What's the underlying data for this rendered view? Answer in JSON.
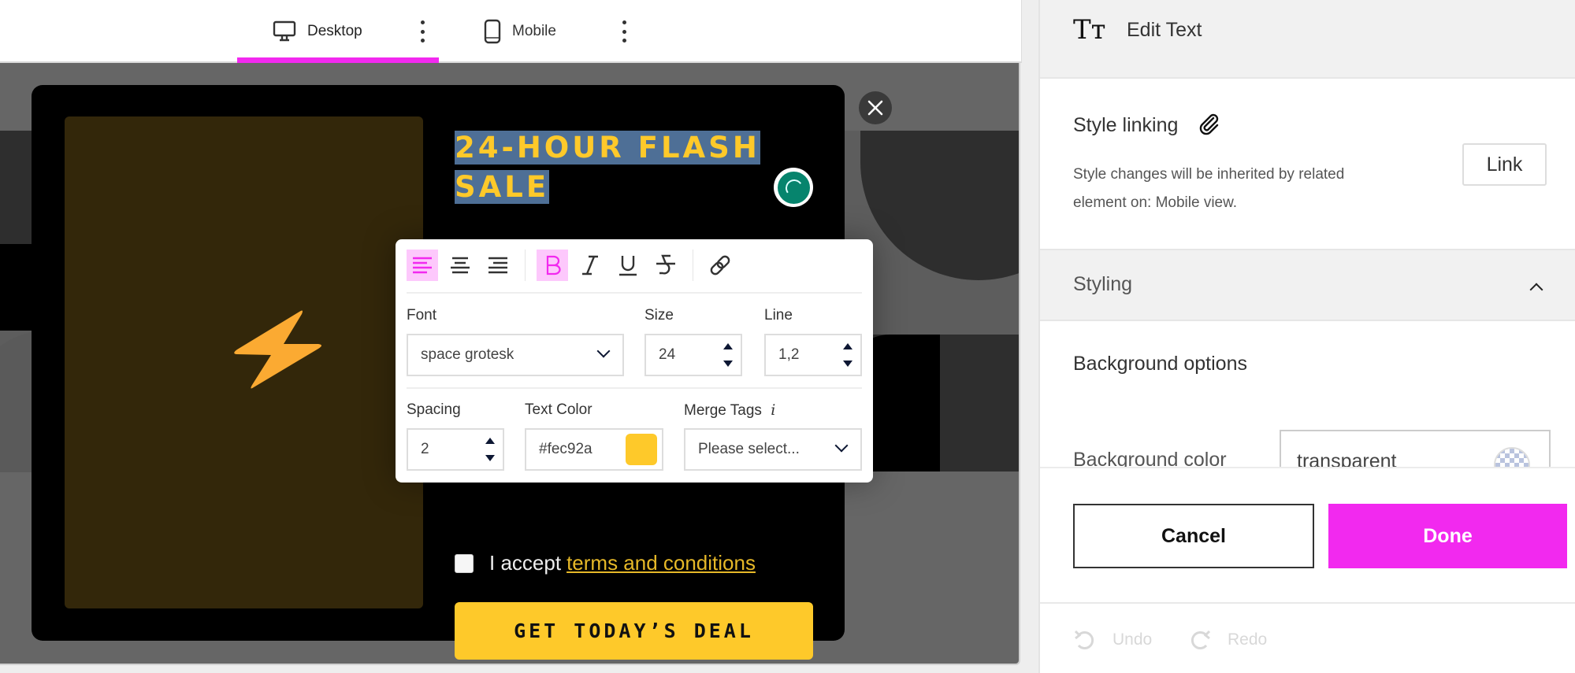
{
  "topbar": {
    "tabs": [
      {
        "label": "Desktop",
        "icon": "desktop-monitor-icon",
        "active": true
      },
      {
        "label": "Mobile",
        "icon": "mobile-phone-icon",
        "active": false
      }
    ],
    "accent_color": "#f229ef"
  },
  "popup_preview": {
    "headline": [
      "24-HOUR FLASH",
      "SALE"
    ],
    "headline_color": "#fec92a",
    "consent_prefix": "I accept",
    "consent_link": "terms and conditions",
    "cta_label": "GET TODAY’S DEAL",
    "image_icon": "lightning-bolt-icon",
    "close_icon": "close-x-icon"
  },
  "text_toolbar": {
    "alignment": [
      "align-left",
      "align-center",
      "align-right"
    ],
    "active_alignment": "align-left",
    "formatting": [
      "bold",
      "italic",
      "underline",
      "strikethrough"
    ],
    "active_formatting": [
      "bold"
    ],
    "link_icon": "link-icon",
    "font": {
      "label": "Font",
      "value": "space grotesk"
    },
    "size": {
      "label": "Size",
      "value": "24"
    },
    "line": {
      "label": "Line",
      "value": "1,2"
    },
    "spacing": {
      "label": "Spacing",
      "value": "2"
    },
    "text_color": {
      "label": "Text Color",
      "value": "#fec92a"
    },
    "merge_tags": {
      "label": "Merge Tags",
      "info_icon": "i",
      "placeholder": "Please select..."
    }
  },
  "panel": {
    "title": "Edit Text",
    "style_linking": {
      "title": "Style linking",
      "description": "Style changes will be inherited by related element on: Mobile view.",
      "button": "Link"
    },
    "styling": {
      "label": "Styling",
      "expanded": true
    },
    "background_options": {
      "title": "Background options",
      "color_label": "Background color",
      "color_value": "transparent"
    },
    "cancel_label": "Cancel",
    "done_label": "Done",
    "undo_label": "Undo",
    "redo_label": "Redo"
  }
}
